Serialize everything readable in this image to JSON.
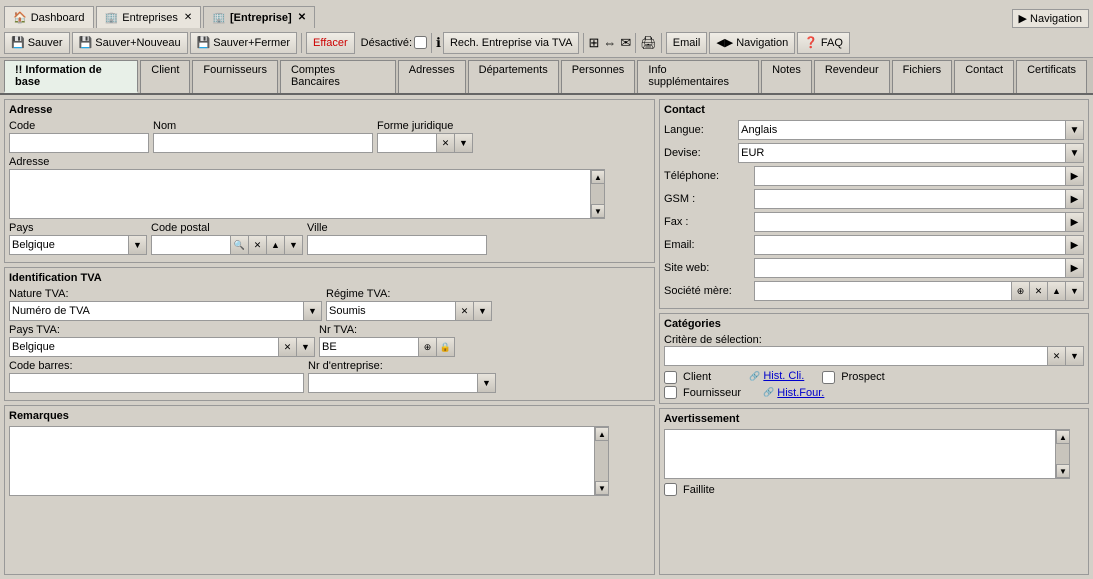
{
  "tabs": [
    {
      "label": "Dashboard",
      "icon": "🏠",
      "active": false,
      "closable": false
    },
    {
      "label": "Entreprises",
      "icon": "🏢",
      "active": false,
      "closable": true
    },
    {
      "label": "[Entreprise]",
      "icon": "🏢",
      "active": true,
      "closable": true
    }
  ],
  "toolbar": {
    "save_label": "Sauver",
    "save_new_label": "Sauver+Nouveau",
    "save_close_label": "Sauver+Fermer",
    "delete_label": "Effacer",
    "desactive_label": "Désactivé:",
    "search_label": "Rech. Entreprise via TVA",
    "email_label": "Email",
    "navigation_label": "Navigation",
    "faq_label": "FAQ"
  },
  "main_tabs": [
    {
      "label": "!! Information de base",
      "active": true
    },
    {
      "label": "Client",
      "active": false
    },
    {
      "label": "Fournisseurs",
      "active": false
    },
    {
      "label": "Comptes Bancaires",
      "active": false
    },
    {
      "label": "Adresses",
      "active": false
    },
    {
      "label": "Départements",
      "active": false
    },
    {
      "label": "Personnes",
      "active": false
    },
    {
      "label": "Info supplémentaires",
      "active": false
    },
    {
      "label": "Notes",
      "active": false
    },
    {
      "label": "Revendeur",
      "active": false
    },
    {
      "label": "Fichiers",
      "active": false
    },
    {
      "label": "Contact",
      "active": false
    },
    {
      "label": "Certificats",
      "active": false
    }
  ],
  "adresse": {
    "title": "Adresse",
    "code_label": "Code",
    "code_value": "",
    "nom_label": "Nom",
    "nom_value": "",
    "forme_juridique_label": "Forme juridique",
    "forme_juridique_value": "",
    "adresse_label": "Adresse",
    "adresse_value": "",
    "pays_label": "Pays",
    "pays_value": "Belgique",
    "code_postal_label": "Code postal",
    "code_postal_value": "",
    "ville_label": "Ville",
    "ville_value": ""
  },
  "identification_tva": {
    "title": "Identification TVA",
    "nature_tva_label": "Nature TVA:",
    "nature_tva_value": "Numéro de TVA",
    "regime_tva_label": "Régime TVA:",
    "regime_tva_value": "Soumis",
    "pays_tva_label": "Pays TVA:",
    "pays_tva_value": "Belgique",
    "nr_tva_label": "Nr TVA:",
    "nr_tva_value": "BE",
    "code_barres_label": "Code barres:",
    "code_barres_value": "",
    "nr_entreprise_label": "Nr d'entreprise:",
    "nr_entreprise_value": ""
  },
  "remarques": {
    "title": "Remarques",
    "value": ""
  },
  "contact": {
    "title": "Contact",
    "langue_label": "Langue:",
    "langue_value": "Anglais",
    "devise_label": "Devise:",
    "devise_value": "EUR",
    "telephone_label": "Téléphone:",
    "telephone_value": "",
    "gsm_label": "GSM :",
    "gsm_value": "",
    "fax_label": "Fax :",
    "fax_value": "",
    "email_label": "Email:",
    "email_value": "",
    "site_web_label": "Site web:",
    "site_web_value": "",
    "societe_mere_label": "Société mère:",
    "societe_mere_value": ""
  },
  "categories": {
    "title": "Catégories",
    "critere_label": "Critère de sélection:",
    "critere_value": "",
    "client_label": "Client",
    "hist_cli_label": "Hist. Cli.",
    "prospect_label": "Prospect",
    "fournisseur_label": "Fournisseur",
    "hist_four_label": "Hist.Four."
  },
  "avertissement": {
    "title": "Avertissement",
    "value": "",
    "faillite_label": "Faillite"
  }
}
